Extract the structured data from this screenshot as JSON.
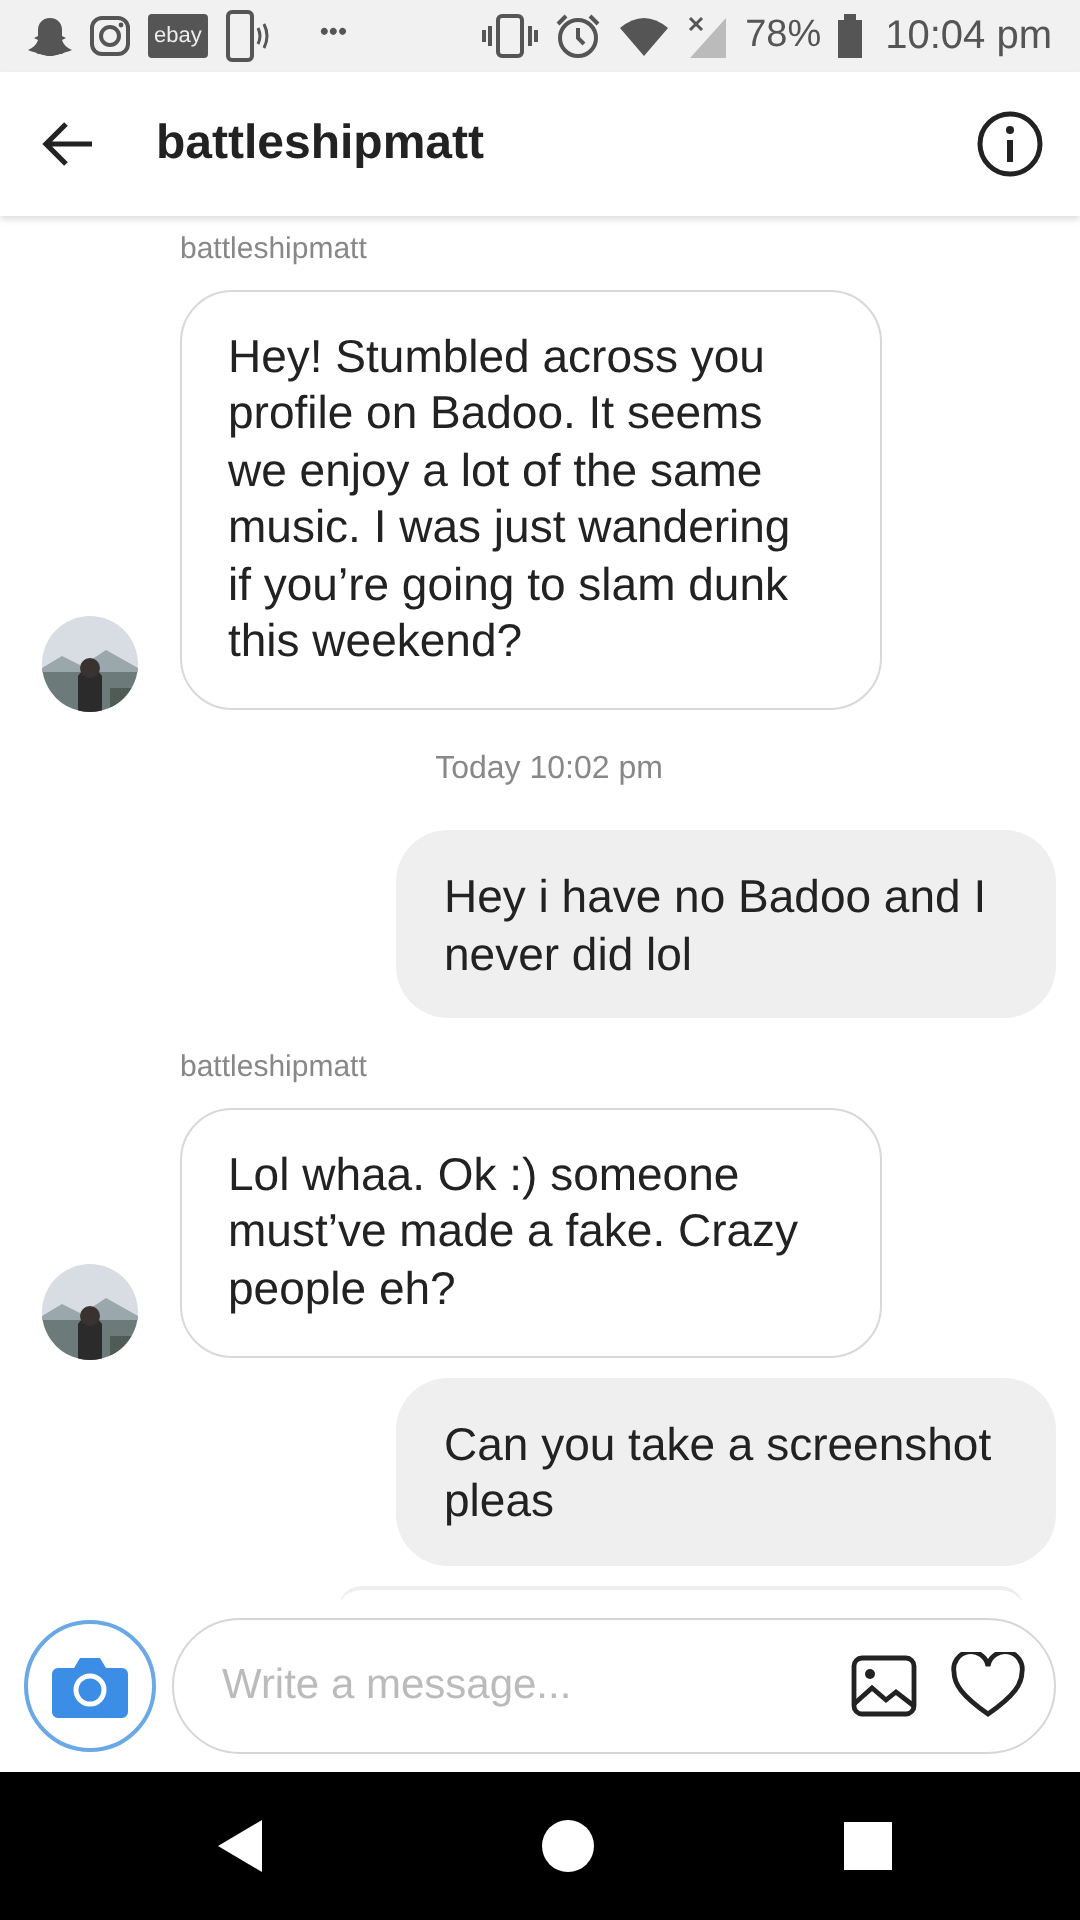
{
  "status_bar": {
    "notification_label": "ebay",
    "more": "•••",
    "battery": "78%",
    "time": "10:04 pm"
  },
  "header": {
    "title": "battleshipmatt"
  },
  "messages": [
    {
      "kind": "sender",
      "text": "battleshipmatt"
    },
    {
      "kind": "incoming",
      "text": "Hey! Stumbled across you profile on Badoo. It seems we enjoy a lot of the same music. I was just wandering if you’re going to slam dunk this weekend?"
    },
    {
      "kind": "timestamp",
      "text": "Today 10:02 pm"
    },
    {
      "kind": "outgoing",
      "text": "Hey i have no Badoo and I never did lol"
    },
    {
      "kind": "sender",
      "text": "battleshipmatt"
    },
    {
      "kind": "incoming",
      "text": "Lol whaa. Ok :) someone must’ve made a fake. Crazy people eh?"
    },
    {
      "kind": "outgoing",
      "text": "Can you take a screenshot pleas"
    }
  ],
  "composer": {
    "placeholder": "Write a message..."
  }
}
